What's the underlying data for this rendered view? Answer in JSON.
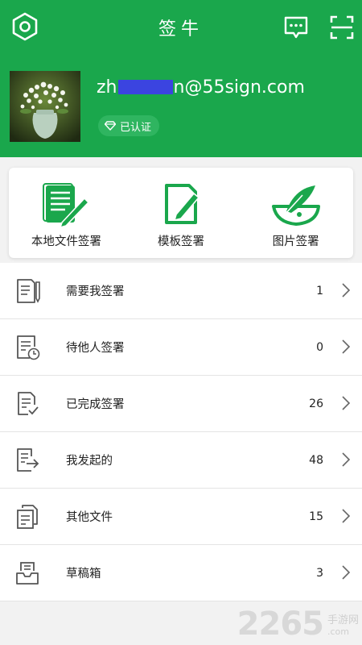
{
  "header": {
    "title": "签牛",
    "email_prefix": "zh",
    "email_suffix": "n@55sign.com",
    "verified_label": "已认证"
  },
  "colors": {
    "brand": "#1aa74c",
    "redaction": "#3b44e0"
  },
  "quick_actions": [
    {
      "label": "本地文件签署",
      "icon": "document-pen-icon"
    },
    {
      "label": "模板签署",
      "icon": "template-edit-icon"
    },
    {
      "label": "图片签署",
      "icon": "image-quill-icon"
    }
  ],
  "list_items": [
    {
      "label": "需要我签署",
      "count": "1",
      "icon": "doc-pen-icon"
    },
    {
      "label": "待他人签署",
      "count": "0",
      "icon": "doc-clock-icon"
    },
    {
      "label": "已完成签署",
      "count": "26",
      "icon": "doc-check-icon"
    },
    {
      "label": "我发起的",
      "count": "48",
      "icon": "doc-send-icon"
    },
    {
      "label": "其他文件",
      "count": "15",
      "icon": "doc-stack-icon"
    },
    {
      "label": "草稿箱",
      "count": "3",
      "icon": "inbox-tray-icon"
    }
  ],
  "watermark": {
    "number": "2265",
    "suffix": "手游网",
    "domain": ".com"
  }
}
